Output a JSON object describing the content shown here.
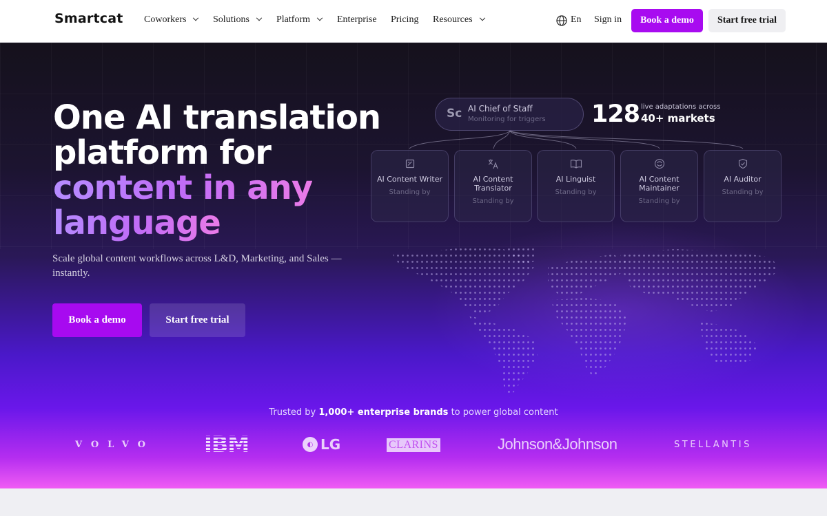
{
  "nav": {
    "logo": "Smartcat",
    "items": [
      {
        "label": "Coworkers",
        "has_dropdown": true
      },
      {
        "label": "Solutions",
        "has_dropdown": true
      },
      {
        "label": "Platform",
        "has_dropdown": true
      },
      {
        "label": "Enterprise",
        "has_dropdown": false
      },
      {
        "label": "Pricing",
        "has_dropdown": false
      },
      {
        "label": "Resources",
        "has_dropdown": true
      }
    ],
    "language": "En",
    "sign_in": "Sign in",
    "book_demo": "Book a demo",
    "start_trial": "Start free trial"
  },
  "hero": {
    "title_line1": "One AI translation",
    "title_line2": "platform for",
    "title_line3": "content in any",
    "title_line4": "language",
    "subtitle": "Scale global content workflows across L&D, Marketing, and Sales — instantly.",
    "book_demo": "Book a demo",
    "start_trial": "Start free trial"
  },
  "chief": {
    "logo": "Sc",
    "title": "AI Chief of Staff",
    "status": "Monitoring for triggers"
  },
  "stats": {
    "number": "128",
    "label_small": "live adaptations across",
    "label_big": "40+ markets"
  },
  "agents": [
    {
      "name": "AI Content Writer",
      "status": "Standing by",
      "icon": "document-edit-icon"
    },
    {
      "name": "AI Content Translator",
      "status": "Standing by",
      "icon": "translate-icon"
    },
    {
      "name": "AI Linguist",
      "status": "Standing by",
      "icon": "book-icon"
    },
    {
      "name": "AI Content Maintainer",
      "status": "Standing by",
      "icon": "refresh-icon"
    },
    {
      "name": "AI Auditor",
      "status": "Standing by",
      "icon": "shield-check-icon"
    }
  ],
  "trusted": {
    "prefix": "Trusted by",
    "highlight": "1,000+ enterprise brands",
    "suffix": "to power global content"
  },
  "brands": [
    "VOLVO",
    "IBM",
    "LG",
    "CLARINS",
    "Johnson&Johnson",
    "STELLANTIS"
  ],
  "colors": {
    "accent": "#a80bf0",
    "hero_dark": "#15111c",
    "hero_purple": "#6a17ea",
    "hero_pink": "#f05cf4"
  }
}
